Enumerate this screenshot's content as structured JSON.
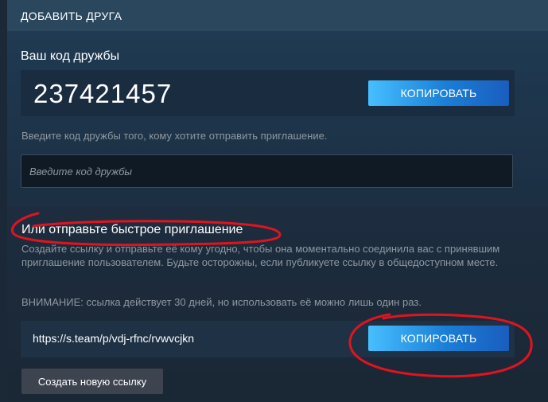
{
  "header": {
    "title": "ДОБАВИТЬ ДРУГА"
  },
  "friend_code": {
    "title": "Ваш код дружбы",
    "value": "237421457",
    "copy_label": "КОПИРОВАТЬ",
    "hint": "Введите код дружбы того, кому хотите отправить приглашение.",
    "input_placeholder": "Введите код дружбы",
    "input_value": ""
  },
  "quick_invite": {
    "title": "Или отправьте быстрое приглашение",
    "description": "Создайте ссылку и отправьте её кому угодно, чтобы она моментально соединила вас с принявшим приглашение пользователем. Будьте осторожны, если публикуете ссылку в общедоступном месте.",
    "warning": "ВНИМАНИЕ: ссылка действует 30 дней, но использовать её можно лишь один раз.",
    "link": "https://s.team/p/vdj-rfnc/rvwvcjkn",
    "copy_label": "КОПИРОВАТЬ",
    "new_link_label": "Создать новую ссылку"
  },
  "colors": {
    "background": "#1b2838",
    "header": "#2a475e",
    "accent_blue": "#1a7fd6",
    "annotation_red": "#e0141e"
  }
}
